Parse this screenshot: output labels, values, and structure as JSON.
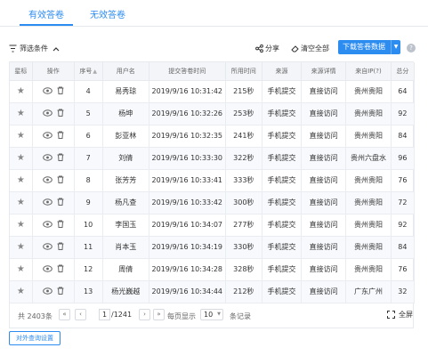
{
  "tabs": [
    {
      "label": "有效答卷",
      "active": true
    },
    {
      "label": "无效答卷",
      "active": false
    }
  ],
  "toolbar": {
    "filter_label": "筛选条件",
    "share_label": "分享",
    "clear_label": "清空全部",
    "download_label": "下载答卷数据"
  },
  "table": {
    "headers": [
      "星标",
      "操作",
      "序号",
      "用户名",
      "提交答卷时间",
      "所用时间",
      "来源",
      "来源详情",
      "来自IP(?)",
      "总分"
    ],
    "rows": [
      {
        "seq": "4",
        "user": "易秀琼",
        "time": "2019/9/16 10:31:42",
        "used": "215秒",
        "source": "手机提交",
        "detail": "直接访问",
        "ip": "贵州贵阳",
        "score": "64"
      },
      {
        "seq": "5",
        "user": "杨坤",
        "time": "2019/9/16 10:32:26",
        "used": "253秒",
        "source": "手机提交",
        "detail": "直接访问",
        "ip": "贵州贵阳",
        "score": "92"
      },
      {
        "seq": "6",
        "user": "彭亚林",
        "time": "2019/9/16 10:32:35",
        "used": "241秒",
        "source": "手机提交",
        "detail": "直接访问",
        "ip": "贵州贵阳",
        "score": "84"
      },
      {
        "seq": "7",
        "user": "刘倩",
        "time": "2019/9/16 10:33:30",
        "used": "322秒",
        "source": "手机提交",
        "detail": "直接访问",
        "ip": "贵州六盘水",
        "score": "96"
      },
      {
        "seq": "8",
        "user": "张芳芳",
        "time": "2019/9/16 10:33:41",
        "used": "333秒",
        "source": "手机提交",
        "detail": "直接访问",
        "ip": "贵州贵阳",
        "score": "76"
      },
      {
        "seq": "9",
        "user": "杨凡查",
        "time": "2019/9/16 10:33:42",
        "used": "300秒",
        "source": "手机提交",
        "detail": "直接访问",
        "ip": "贵州贵阳",
        "score": "72"
      },
      {
        "seq": "10",
        "user": "李国玉",
        "time": "2019/9/16 10:34:07",
        "used": "277秒",
        "source": "手机提交",
        "detail": "直接访问",
        "ip": "贵州贵阳",
        "score": "92"
      },
      {
        "seq": "11",
        "user": "肖本玉",
        "time": "2019/9/16 10:34:19",
        "used": "330秒",
        "source": "手机提交",
        "detail": "直接访问",
        "ip": "贵州贵阳",
        "score": "84"
      },
      {
        "seq": "12",
        "user": "周倩",
        "time": "2019/9/16 10:34:28",
        "used": "328秒",
        "source": "手机提交",
        "detail": "直接访问",
        "ip": "贵州贵阳",
        "score": "76"
      },
      {
        "seq": "13",
        "user": "杨光巍越",
        "time": "2019/9/16 10:34:44",
        "used": "212秒",
        "source": "手机提交",
        "detail": "直接访问",
        "ip": "广东广州",
        "score": "32"
      }
    ]
  },
  "pager": {
    "total": "共 2403条",
    "first": "«",
    "prev": "‹",
    "current": "1",
    "of_total": "/1241",
    "next": "›",
    "last": "»",
    "per_page_label": "每页显示",
    "per_page_value": "10",
    "records_label": "条记录",
    "fullscreen_label": "全屏"
  },
  "external_query_label": "对外查询设置",
  "colors": {
    "accent": "#2d8cf0",
    "header_bg": "#f3f5f8",
    "row_alt": "#f7f9fc",
    "border": "#e6e9ee"
  }
}
